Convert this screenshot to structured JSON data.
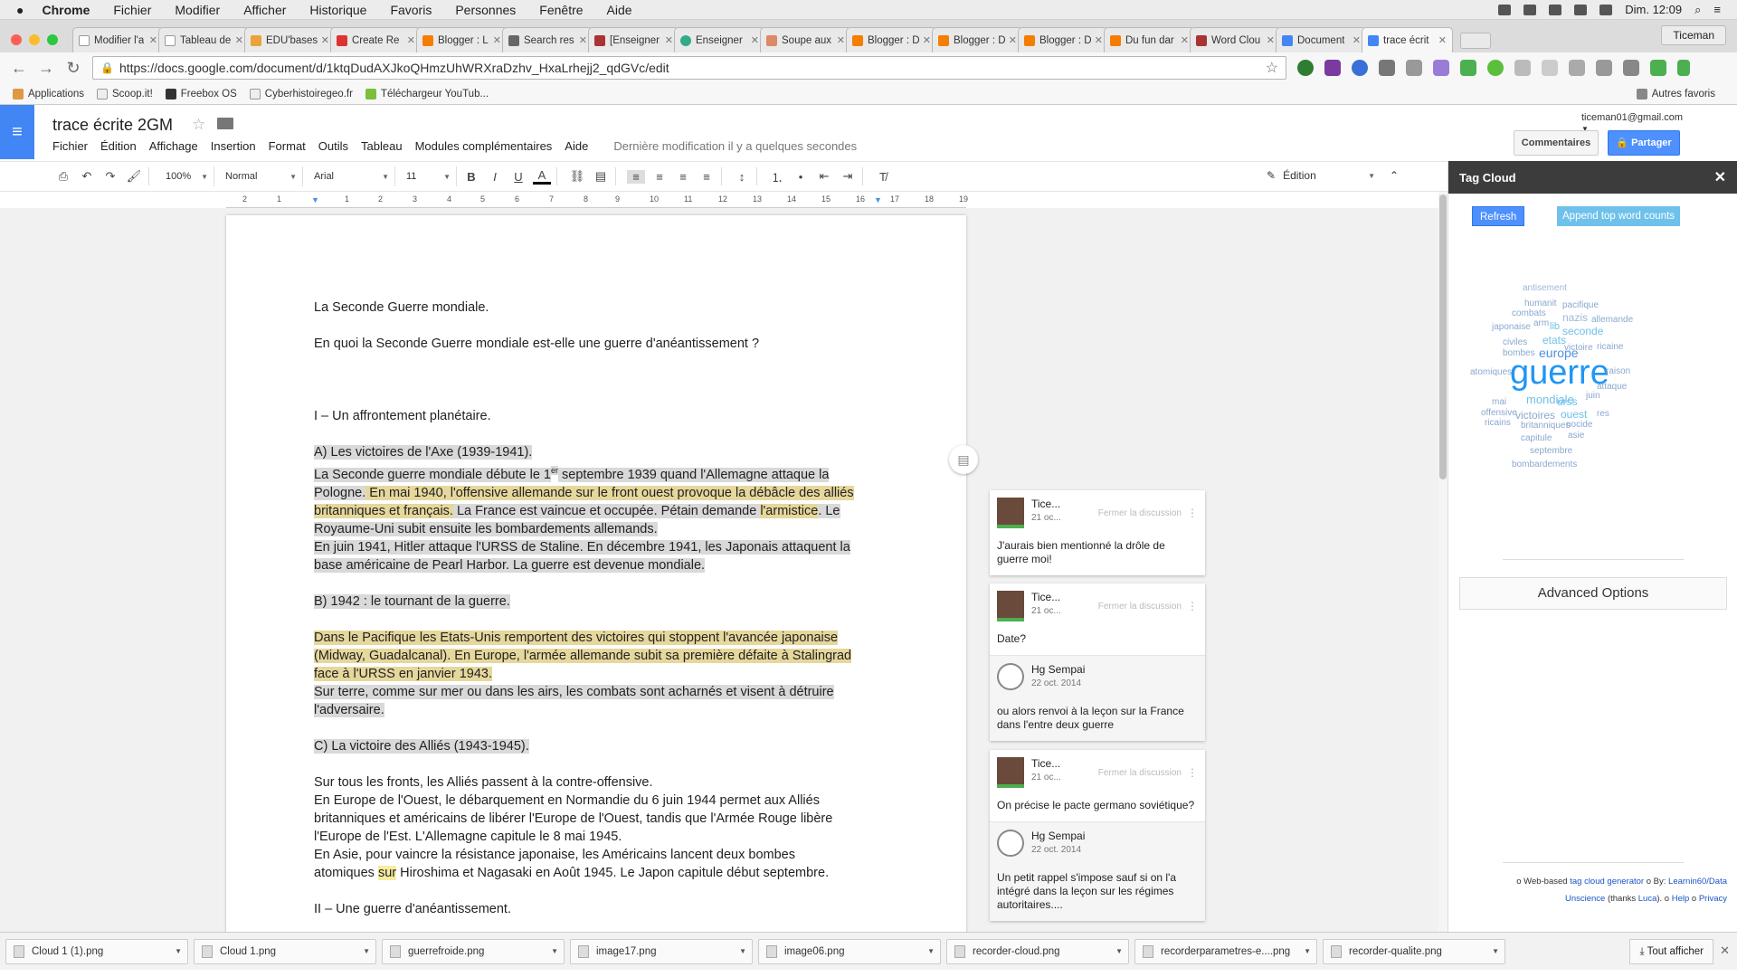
{
  "macmenu": {
    "app": "Chrome",
    "items": [
      "Fichier",
      "Modifier",
      "Afficher",
      "Historique",
      "Favoris",
      "Personnes",
      "Fenêtre",
      "Aide"
    ],
    "clock": "Dim. 12:09"
  },
  "tabs": [
    {
      "label": "Modifier l'a",
      "color": "#ffffff"
    },
    {
      "label": "Tableau de",
      "color": "#ffffff"
    },
    {
      "label": "EDU'bases",
      "color": "#e8a33b"
    },
    {
      "label": "Create Re",
      "color": "#d33"
    },
    {
      "label": "Blogger : L",
      "color": "#f57d00"
    },
    {
      "label": "Search res",
      "color": "#666"
    },
    {
      "label": "[Enseigner",
      "color": "#a33"
    },
    {
      "label": "Enseigner",
      "color": "#3a8"
    },
    {
      "label": "Soupe aux",
      "color": "#d86"
    },
    {
      "label": "Blogger : D",
      "color": "#f57d00"
    },
    {
      "label": "Blogger : D",
      "color": "#f57d00"
    },
    {
      "label": "Blogger : D",
      "color": "#f57d00"
    },
    {
      "label": "Du fun dar",
      "color": "#f57d00"
    },
    {
      "label": "Word Clou",
      "color": "#a33"
    },
    {
      "label": "Document",
      "color": "#4285f4"
    },
    {
      "label": "trace écrit",
      "color": "#4285f4"
    }
  ],
  "profile": "Ticeman",
  "url": "https://docs.google.com/document/d/1ktqDudAXJkoQHmzUhWRXraDzhv_HxaLrhejj2_qdGVc/edit",
  "bookmarks": {
    "items": [
      "Applications",
      "Scoop.it!",
      "Freebox OS",
      "Cyberhistoiregeo.fr",
      "Téléchargeur YouTub..."
    ],
    "other": "Autres favoris"
  },
  "doc": {
    "title": "trace écrite 2GM",
    "menus": [
      "Fichier",
      "Édition",
      "Affichage",
      "Insertion",
      "Format",
      "Outils",
      "Tableau",
      "Modules complémentaires",
      "Aide"
    ],
    "lastmod": "Dernière modification il y a quelques secondes",
    "account": "ticeman01@gmail.com",
    "comments_btn": "Commentaires",
    "share_btn": "Partager"
  },
  "format": {
    "zoom": "100%",
    "style": "Normal",
    "font": "Arial",
    "size": "11",
    "mode": "Édition"
  },
  "ruler": [
    "2",
    "1",
    "1",
    "2",
    "3",
    "4",
    "5",
    "6",
    "7",
    "8",
    "9",
    "10",
    "11",
    "12",
    "13",
    "14",
    "15",
    "16",
    "17",
    "18",
    "19"
  ],
  "content": {
    "title": "La Seconde Guerre mondiale.",
    "question": "En quoi la Seconde Guerre mondiale est-elle une guerre d'anéantissement ?",
    "part1": "I – Un affrontement planétaire.",
    "secA": "A) Les victoires de l'Axe (1939-1941).",
    "pA1a": "La Seconde guerre mondiale débute le 1",
    "pA1sup": "er",
    "pA1b": " septembre 1939 quand l'Allemagne attaque la Pologne.",
    "pA1c": " En mai 1940, l'offensive allemande sur le front ouest provoque la débâcle des alliés britanniques et français.",
    "pA1d": " La France est vaincue et occupée. Pétain demande ",
    "pA1e": "l'armistice",
    "pA1f": ". Le Royaume-Uni subit ensuite les bombardements allemands.",
    "pA2": "En juin 1941, Hitler attaque l'URSS de Staline. En décembre 1941, les Japonais attaquent la base américaine de Pearl Harbor. La guerre est devenue mondiale.",
    "secB": "B) 1942 : le tournant de la guerre.",
    "pB1": "Dans le Pacifique les Etats-Unis remportent des victoires qui stoppent l'avancée japonaise (Midway, Guadalcanal). En Europe, l'armée allemande subit sa première défaite à Stalingrad face à l'URSS en janvier 1943.",
    "pB2": "Sur terre, comme sur mer ou dans les airs, les combats sont acharnés et visent à détruire l'adversaire.",
    "secC": "C) La victoire des Alliés (1943-1945).",
    "pC1": "Sur tous les fronts, les Alliés passent à la contre-offensive.",
    "pC2": "En Europe de l'Ouest, le débarquement en Normandie du 6 juin 1944 permet aux Alliés britanniques et américains de libérer l'Europe de l'Ouest, tandis que l'Armée Rouge libère l'Europe de l'Est. L'Allemagne capitule le 8 mai 1945.",
    "pC3a": "En Asie, pour vaincre la résistance japonaise, les Américains lancent deux bombes atomiques ",
    "pC3b": "sur",
    "pC3c": " Hiroshima et Nagasaki en Août 1945. Le Japon capitule début septembre.",
    "part2": "II – Une guerre d'anéantissement."
  },
  "comments": [
    {
      "author": "Tice...",
      "date": "21 oc...",
      "close": "Fermer la discussion",
      "text": "J'aurais bien mentionné la drôle de guerre moi!"
    },
    {
      "author": "Tice...",
      "date": "21 oc...",
      "close": "Fermer la discussion",
      "text": "Date?",
      "reply": {
        "author": "Hg Sempai",
        "date": "22 oct. 2014",
        "text": "ou alors renvoi à la leçon sur la France dans l'entre deux guerre"
      }
    },
    {
      "author": "Tice...",
      "date": "21 oc...",
      "close": "Fermer la discussion",
      "text": "On précise le pacte germano soviétique?",
      "reply": {
        "author": "Hg Sempai",
        "date": "22 oct. 2014",
        "text": "Un petit rappel s'impose sauf si on l'a intégré dans la leçon sur les régimes autoritaires...."
      }
    }
  ],
  "sidebar": {
    "title": "Tag Cloud",
    "refresh": "Refresh",
    "append": "Append top word counts",
    "advanced": "Advanced Options",
    "credits": {
      "l1a": "o Web-based ",
      "l1b": "tag cloud generator",
      "l1c": " o By: ",
      "l1d": "Learnin60/Data",
      "l2a": "Unscience",
      "l2b": " (thanks ",
      "l2c": "Luca",
      "l2d": "). o ",
      "l2e": "Help",
      "l2f": " o ",
      "l2g": "Privacy"
    },
    "words": [
      "antisement",
      "humanit",
      "pacifique",
      "combats",
      "nazis",
      "allemande",
      "japonaise",
      "arm",
      "lib",
      "seconde",
      "civiles",
      "etats",
      "victoire",
      "ricaine",
      "bombes",
      "europe",
      "atomiques",
      "guerre",
      "raison",
      "attaque",
      "mondiale",
      "juin",
      "mai",
      "urss",
      "offensive",
      "victoires",
      "ouest",
      "res",
      "ricains",
      "britanniques",
      "nocide",
      "capitule",
      "asie",
      "septembre",
      "bombardements"
    ]
  },
  "downloads": {
    "files": [
      "Cloud 1 (1).png",
      "Cloud 1.png",
      "guerrefroide.png",
      "image17.png",
      "image06.png",
      "recorder-cloud.png",
      "recorderparametres-e....png",
      "recorder-qualite.png"
    ],
    "show_all": "Tout afficher"
  }
}
